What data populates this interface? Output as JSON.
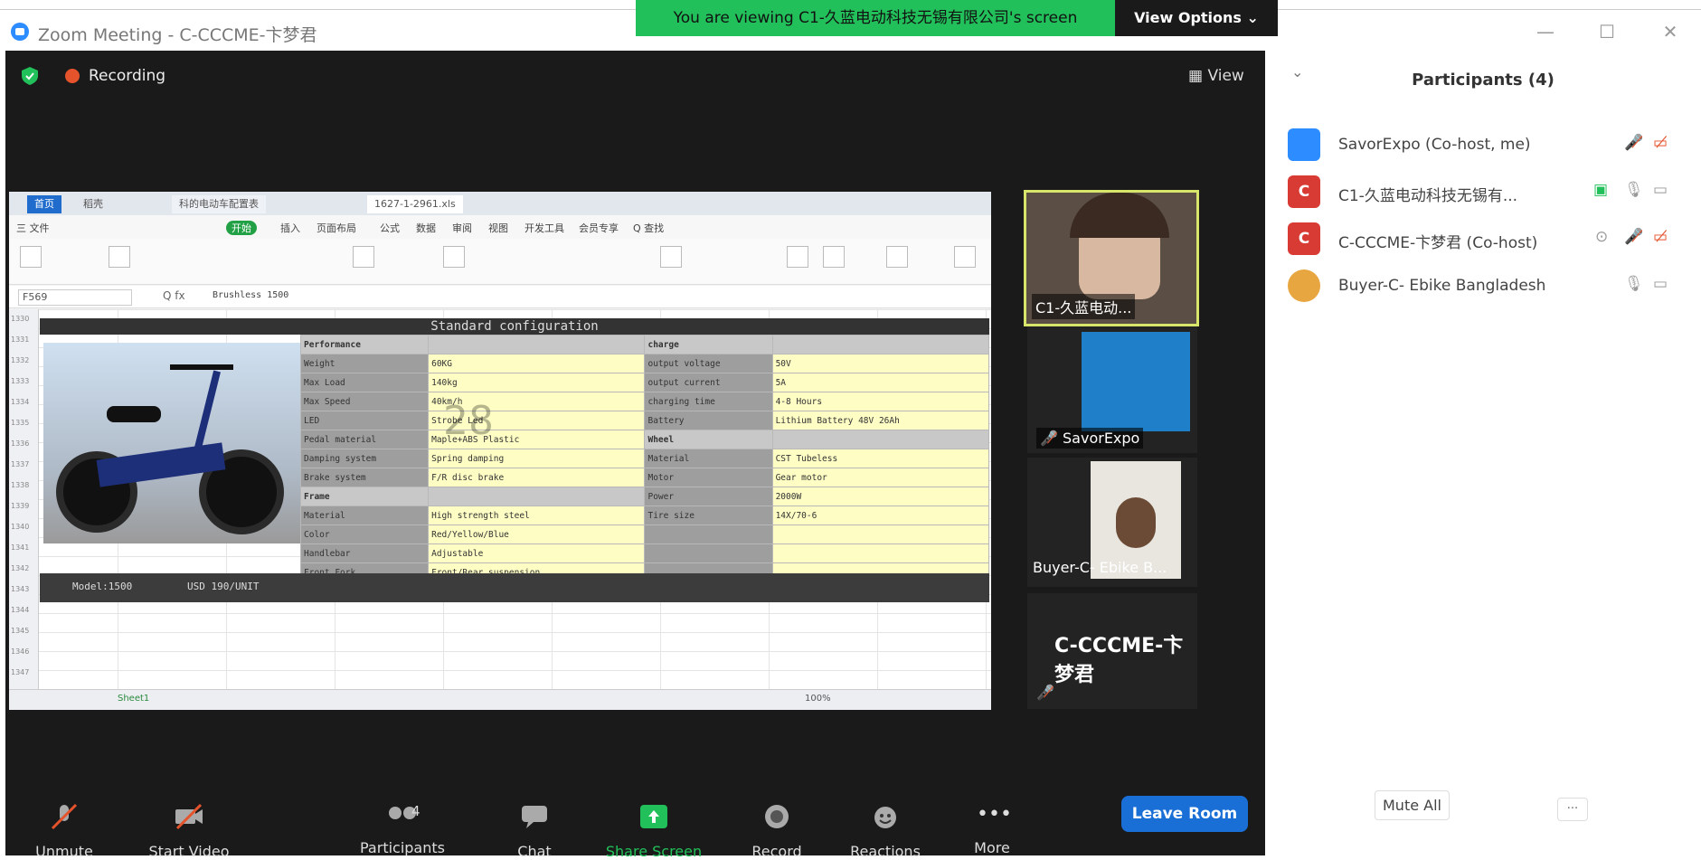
{
  "window": {
    "title": "Zoom Meeting - C-CCCME-卞梦君",
    "viewing_banner": "You are viewing C1-久蓝电动科技无锡有限公司's screen",
    "view_options": "View Options ⌄",
    "minimize": "—",
    "maximize": "☐",
    "close": "✕"
  },
  "meeting": {
    "recording_label": "Recording",
    "view_label": "▦ View"
  },
  "spreadsheet": {
    "tabs": [
      "首页",
      "稻壳",
      "科的电动车配置表",
      "1627-1-2961.xls"
    ],
    "menu": [
      "三 文件",
      "开始",
      "插入",
      "页面布局",
      "公式",
      "数据",
      "审阅",
      "视图",
      "开发工具",
      "会员专享",
      "Q 查找"
    ],
    "cell_ref": "F569",
    "fx": "Q fx",
    "formula_value": "Brushless 1500",
    "config_title": "Standard configuration",
    "rows": [
      {
        "k1": "Performance",
        "v1": "",
        "k2": "charge",
        "v2": "",
        "head": true
      },
      {
        "k1": "Weight",
        "v1": "60KG",
        "k2": "output voltage",
        "v2": "50V"
      },
      {
        "k1": "Max Load",
        "v1": "140kg",
        "k2": "output current",
        "v2": "5A"
      },
      {
        "k1": "Max Speed",
        "v1": "40km/h",
        "k2": "charging time",
        "v2": "4-8 Hours"
      },
      {
        "k1": "LED",
        "v1": "Strobe Led",
        "k2": "Battery",
        "v2": "Lithium Battery 48V 26Ah"
      },
      {
        "k1": "Pedal material",
        "v1": "Maple+ABS Plastic",
        "k2": "Wheel",
        "v2": "",
        "head2": true
      },
      {
        "k1": "Damping system",
        "v1": "Spring damping",
        "k2": "Material",
        "v2": "CST Tubeless"
      },
      {
        "k1": "Brake system",
        "v1": "F/R disc brake",
        "k2": "Motor",
        "v2": "Gear motor"
      },
      {
        "k1": "Frame",
        "v1": "",
        "k2": "Power",
        "v2": "2000W",
        "head": true
      },
      {
        "k1": "Material",
        "v1": "High strength steel",
        "k2": "Tire size",
        "v2": "14X/70-6"
      },
      {
        "k1": "Color",
        "v1": "Red/Yellow/Blue",
        "k2": "",
        "v2": ""
      },
      {
        "k1": "Handlebar",
        "v1": "Adjustable",
        "k2": "",
        "v2": ""
      },
      {
        "k1": "Front Fork",
        "v1": "Front/Rear suspension",
        "k2": "",
        "v2": ""
      }
    ],
    "model": "Model:1500",
    "price": "USD 190/UNIT",
    "watermark": "28",
    "row_numbers": [
      "1330",
      "1331",
      "1332",
      "1333",
      "1334",
      "1335",
      "1336",
      "1337",
      "1338",
      "1339",
      "1340",
      "1341",
      "1342",
      "1343",
      "1344",
      "1345",
      "1346",
      "1347"
    ],
    "sheet_tab": "Sheet1",
    "zoom": "100%"
  },
  "tiles": [
    {
      "label": "C1-久蓝电动..."
    },
    {
      "label": "SavorExpo"
    },
    {
      "label": "Buyer-C- Ebike B..."
    },
    {
      "label": "C-CCCME-卞梦君"
    }
  ],
  "toolbar": {
    "unmute": "Unmute",
    "start_video": "Start Video",
    "participants": "Participants",
    "participants_count": "4",
    "chat": "Chat",
    "share_screen": "Share Screen",
    "record": "Record",
    "reactions": "Reactions",
    "more": "More",
    "leave": "Leave Room"
  },
  "participants_panel": {
    "title": "Participants (4)",
    "collapse": "⌄",
    "list": [
      {
        "initial": "",
        "name": "SavorExpo (Co-host, me)",
        "color": "#2d8cff"
      },
      {
        "initial": "C",
        "name": "C1-久蓝电动科技无锡有...",
        "color": "#d83a34"
      },
      {
        "initial": "C",
        "name": "C-CCCME-卞梦君 (Co-host)",
        "color": "#d83a34"
      },
      {
        "initial": "",
        "name": "Buyer-C- Ebike Bangladesh",
        "color": "#e8a640"
      }
    ],
    "mute_all": "Mute All",
    "more": "..."
  },
  "colors": {
    "banner": "#22c05a",
    "accent": "#1a6fd6",
    "muted": "#e5532d",
    "active_speaker": "#d7e66a"
  }
}
